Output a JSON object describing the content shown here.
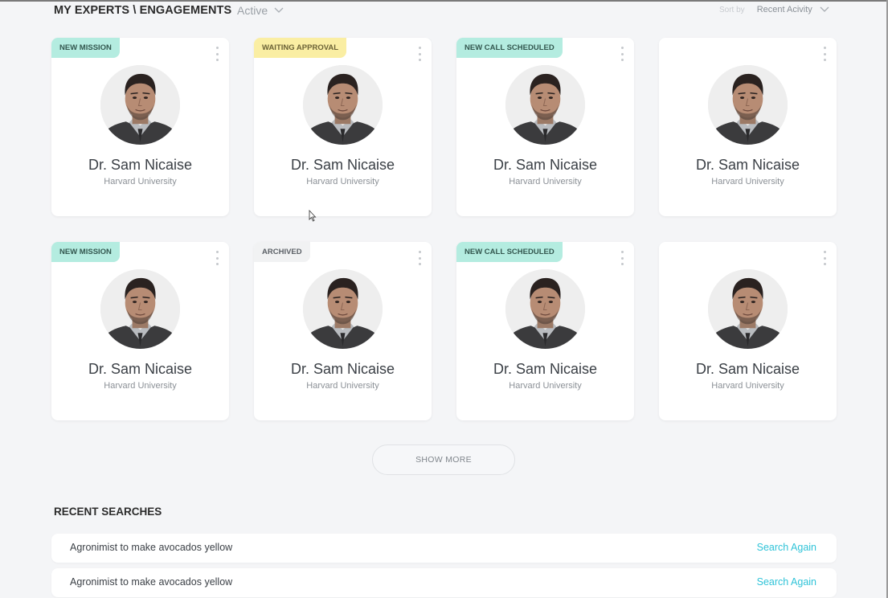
{
  "header": {
    "title": "MY EXPERTS \\ ENGAGEMENTS",
    "filter_value": "Active",
    "sort_label": "Sort by",
    "sort_value": "Recent Acivity"
  },
  "colors": {
    "badge_green": "#b4ece0",
    "badge_yellow": "#faeea3",
    "badge_gray": "#f1f2f3",
    "link": "#2fc3d8"
  },
  "experts": [
    {
      "badge": "NEW MISSION",
      "badge_type": "green",
      "name": "Dr. Sam Nicaise",
      "org": "Harvard University"
    },
    {
      "badge": "WAITING APPROVAL",
      "badge_type": "yellow",
      "name": "Dr. Sam Nicaise",
      "org": "Harvard University"
    },
    {
      "badge": "NEW CALL SCHEDULED",
      "badge_type": "green",
      "name": "Dr. Sam Nicaise",
      "org": "Harvard University"
    },
    {
      "badge": "",
      "badge_type": "",
      "name": "Dr. Sam Nicaise",
      "org": "Harvard University"
    },
    {
      "badge": "NEW MISSION",
      "badge_type": "green",
      "name": "Dr. Sam Nicaise",
      "org": "Harvard University"
    },
    {
      "badge": "ARCHIVED",
      "badge_type": "gray",
      "name": "Dr. Sam Nicaise",
      "org": "Harvard University"
    },
    {
      "badge": "NEW CALL SCHEDULED",
      "badge_type": "green",
      "name": "Dr. Sam Nicaise",
      "org": "Harvard University"
    },
    {
      "badge": "",
      "badge_type": "",
      "name": "Dr. Sam Nicaise",
      "org": "Harvard University"
    }
  ],
  "show_more_label": "SHOW MORE",
  "recent_searches": {
    "title": "RECENT SEARCHES",
    "items": [
      {
        "query": "Agronimist to make avocados yellow",
        "action": "Search Again"
      },
      {
        "query": "Agronimist to make avocados yellow",
        "action": "Search Again"
      }
    ]
  }
}
